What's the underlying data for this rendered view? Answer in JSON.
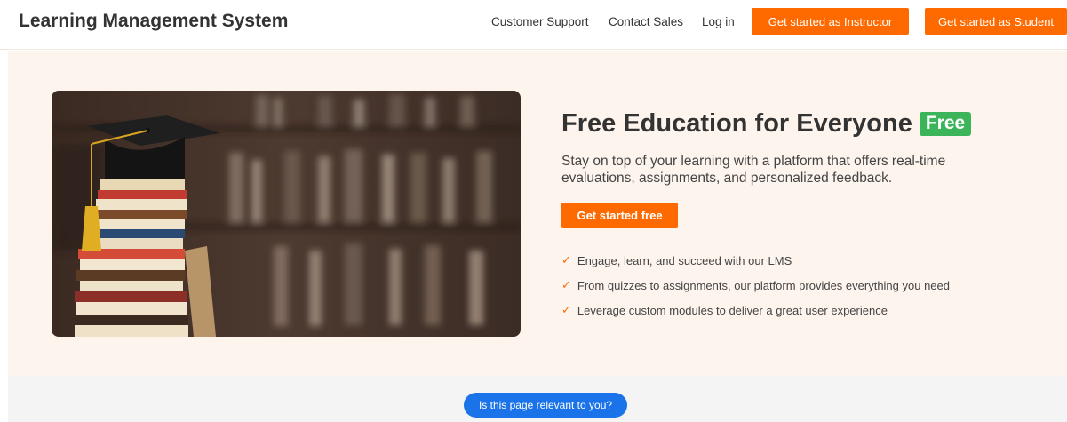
{
  "header": {
    "brand": "Learning Management System",
    "nav": {
      "support": "Customer Support",
      "sales": "Contact Sales",
      "login": "Log in"
    },
    "cta_instructor": "Get started as Instructor",
    "cta_student": "Get started as Student"
  },
  "hero": {
    "title": "Free Education for Everyone",
    "badge": "Free",
    "description": "Stay on top of your learning with a platform that offers real-time evaluations, assignments, and personalized feedback.",
    "cta": "Get started free",
    "features": [
      "Engage, learn, and succeed with our LMS",
      "From quizzes to assignments, our platform provides everything you need",
      "Leverage custom modules to deliver a great user experience"
    ],
    "check_glyph": "✓"
  },
  "feedback": {
    "label": "Is this page relevant to you?"
  },
  "colors": {
    "accent": "#ff6a00",
    "badge": "#3cb55a",
    "hero_bg": "#fdf4ed",
    "feedback": "#1a73e8"
  },
  "icons": {
    "check": "check-icon",
    "hero_image": "graduation-books-photo"
  }
}
